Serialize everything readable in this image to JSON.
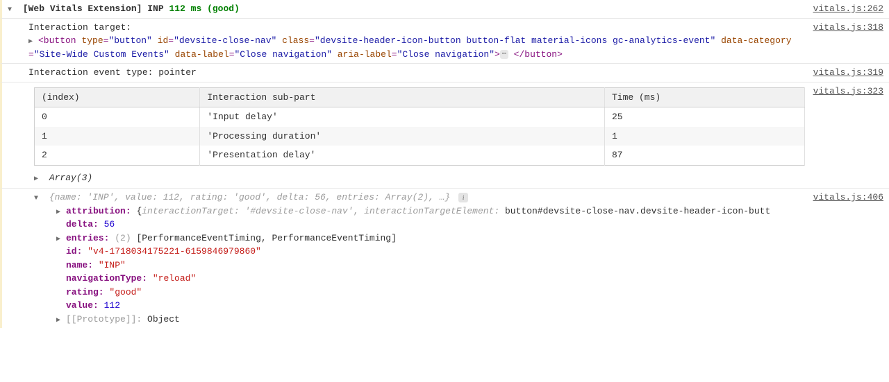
{
  "header": {
    "prefix": "[Web Vitals Extension] INP",
    "value": "112 ms (good)",
    "source": "vitals.js:262"
  },
  "target": {
    "label": "Interaction target:",
    "source": "vitals.js:318",
    "tag_open": "<button",
    "attr_type_k": "type",
    "attr_type_v": "\"button\"",
    "attr_id_k": "id",
    "attr_id_v": "\"devsite-close-nav\"",
    "attr_class_k": "class",
    "attr_class_v": "\"devsite-header-icon-button button-flat material-icons gc-analytics-event\"",
    "attr_datacat_k": "data-category",
    "attr_datacat_v": "\"Site-Wide Custom Events\"",
    "attr_datalabel_k": "data-label",
    "attr_datalabel_v": "\"Close navigation\"",
    "attr_aria_k": "aria-label",
    "attr_aria_v": "\"Close navigation\"",
    "tag_close": "</button>"
  },
  "event_type": {
    "text": "Interaction event type: pointer",
    "source": "vitals.js:319"
  },
  "table_source": "vitals.js:323",
  "table": {
    "h0": "(index)",
    "h1": "Interaction sub-part",
    "h2": "Time (ms)",
    "rows": [
      {
        "idx": "0",
        "part": "'Input delay'",
        "time": "25"
      },
      {
        "idx": "1",
        "part": "'Processing duration'",
        "time": "1"
      },
      {
        "idx": "2",
        "part": "'Presentation delay'",
        "time": "87"
      }
    ],
    "footer": "Array(3)"
  },
  "obj": {
    "source": "vitals.js:406",
    "summary_open": "{",
    "summary_name_k": "name:",
    "summary_name_v": "'INP'",
    "summary_value_k": "value:",
    "summary_value_v": "112",
    "summary_rating_k": "rating:",
    "summary_rating_v": "'good'",
    "summary_delta_k": "delta:",
    "summary_delta_v": "56",
    "summary_entries_k": "entries:",
    "summary_entries_v": "Array(2)",
    "summary_more": ", …}",
    "attribution_k": "attribution:",
    "attribution_open": "{",
    "attribution_it_k": "interactionTarget:",
    "attribution_it_v": "'#devsite-close-nav'",
    "attribution_ite_k": "interactionTargetElement:",
    "attribution_ite_v": "button#devsite-close-nav.devsite-header-icon-butt",
    "delta_k": "delta:",
    "delta_v": "56",
    "entries_k": "entries:",
    "entries_count": "(2)",
    "entries_v": "[PerformanceEventTiming, PerformanceEventTiming]",
    "id_k": "id:",
    "id_v": "\"v4-1718034175221-6159846979860\"",
    "name_k": "name:",
    "name_v": "\"INP\"",
    "nav_k": "navigationType:",
    "nav_v": "\"reload\"",
    "rating_k": "rating:",
    "rating_v": "\"good\"",
    "value_k": "value:",
    "value_v": "112",
    "proto_k": "[[Prototype]]:",
    "proto_v": "Object"
  }
}
